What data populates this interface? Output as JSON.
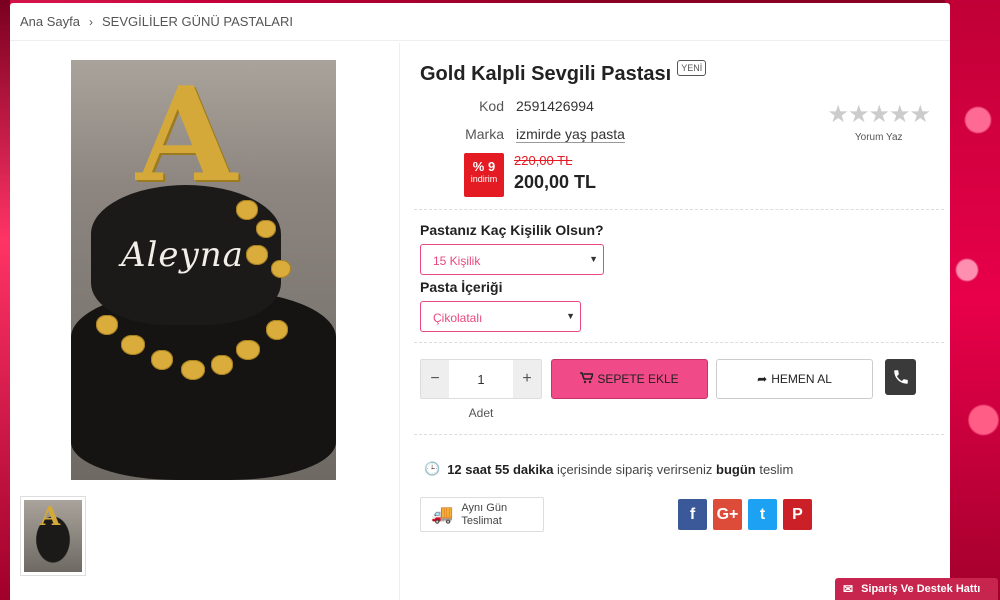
{
  "breadcrumb": {
    "home": "Ana Sayfa",
    "separator": "›",
    "category": "SEVGİLİLER GÜNÜ PASTALARI"
  },
  "product": {
    "title": "Gold Kalpli Sevgili Pastası",
    "badge": "YENİ",
    "code_label": "Kod",
    "code_value": "2591426994",
    "brand_label": "Marka",
    "brand_value": "izmirde yaş pasta",
    "cake_text": "Aleyna",
    "cake_letter": "A"
  },
  "rating": {
    "stars": "★★★★★",
    "review_link": "Yorum Yaz"
  },
  "price": {
    "discount_pct": "% 9",
    "discount_label": "indirim",
    "old_price": "220,00 TL",
    "new_price": "200,00 TL"
  },
  "options": {
    "size_label": "Pastanız Kaç Kişilik Olsun?",
    "size_selected": "15 Kişilik",
    "content_label": "Pasta İçeriği",
    "content_selected": "Çikolatalı"
  },
  "cart": {
    "minus": "−",
    "plus": "+",
    "quantity": "1",
    "quantity_label": "Adet",
    "add_to_cart": "SEPETE EKLE",
    "buy_now": "HEMEN AL"
  },
  "delivery": {
    "time_bold": "12 saat 55 dakika",
    "middle_text": " içerisinde sipariş verirseniz ",
    "day_bold": "bugün",
    "end_text": " teslim",
    "same_day_line1": "Aynı Gün",
    "same_day_line2": "Teslimat"
  },
  "social": {
    "facebook": "f",
    "google_plus": "G+",
    "twitter": "t",
    "pinterest": "P"
  },
  "support": {
    "label": "Sipariş Ve Destek Hattı"
  },
  "colors": {
    "accent_pink": "#f04a88",
    "discount_red": "#e41b23",
    "facebook": "#3b5998",
    "google_plus": "#dd4b39",
    "twitter": "#1da1f2",
    "pinterest": "#cb2027"
  }
}
